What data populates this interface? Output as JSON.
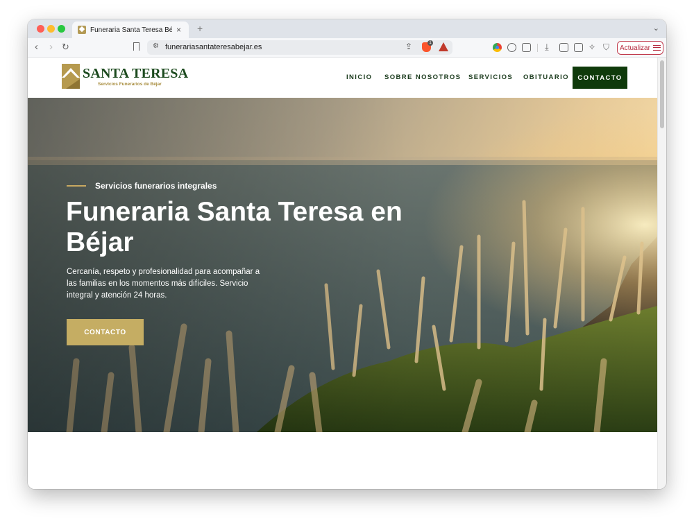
{
  "browser": {
    "tab_title": "Funeraria Santa Teresa Béjar |",
    "tab_close": "×",
    "new_tab": "+",
    "tab_menu": "⌄",
    "url": "funerariasantateresabejar.es",
    "brave_badge_count": "1",
    "update_button": "Actualizar"
  },
  "site": {
    "logo_name": "SANTA TERESA",
    "logo_subtitle": "Servicios Funerarios de Béjar",
    "nav": [
      "INICIO",
      "SOBRE NOSOTROS",
      "SERVICIOS",
      "OBITUARIO"
    ],
    "nav_cta": "CONTACTO",
    "brand_green": "#0f3a0b",
    "brand_gold": "#c5ad63"
  },
  "hero": {
    "eyebrow": "Servicios funerarios integrales",
    "title": "Funeraria Santa Teresa en Béjar",
    "description": "Cercanía, respeto y profesionalidad para acompañar a las familias en los momentos más difíciles. Servicio integral y atención 24 horas.",
    "cta": "CONTACTO"
  }
}
